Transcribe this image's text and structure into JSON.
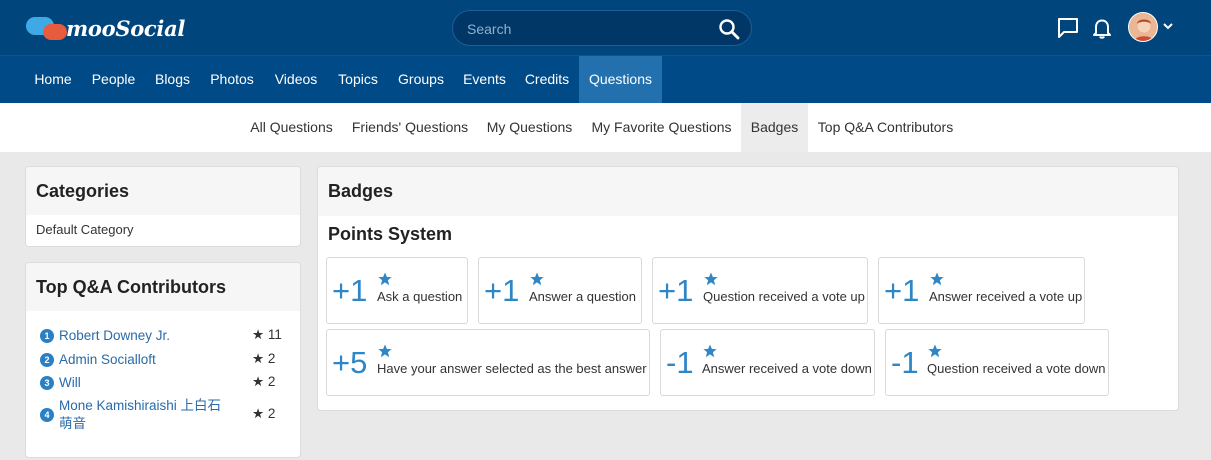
{
  "header": {
    "logo_text": "mooSocial",
    "search_placeholder": "Search"
  },
  "main_nav": [
    {
      "label": "Home"
    },
    {
      "label": "People"
    },
    {
      "label": "Blogs"
    },
    {
      "label": "Photos"
    },
    {
      "label": "Videos"
    },
    {
      "label": "Topics"
    },
    {
      "label": "Groups"
    },
    {
      "label": "Events"
    },
    {
      "label": "Credits"
    },
    {
      "label": "Questions",
      "active": true
    }
  ],
  "sub_nav": [
    {
      "label": "All Questions"
    },
    {
      "label": "Friends' Questions"
    },
    {
      "label": "My Questions"
    },
    {
      "label": "My Favorite Questions"
    },
    {
      "label": "Badges",
      "active": true
    },
    {
      "label": "Top Q&A Contributors"
    }
  ],
  "sidebar": {
    "categories": {
      "title": "Categories",
      "items": [
        "Default Category"
      ]
    },
    "contributors": {
      "title": "Top Q&A Contributors",
      "items": [
        {
          "rank": "1",
          "name": "Robert Downey Jr.",
          "points": "★ 11"
        },
        {
          "rank": "2",
          "name": "Admin Socialloft",
          "points": "★ 2"
        },
        {
          "rank": "3",
          "name": "Will",
          "points": "★ 2"
        },
        {
          "rank": "4",
          "name_line1": "Mone Kamishiraishi 上白石",
          "name_line2": "萌音",
          "points": "★ 2"
        }
      ]
    }
  },
  "badges": {
    "title": "Badges",
    "section_title": "Points System",
    "points": [
      {
        "value": "+1",
        "label": "Ask a question"
      },
      {
        "value": "+1",
        "label": "Answer a question"
      },
      {
        "value": "+1",
        "label": "Question received a vote up"
      },
      {
        "value": "+1",
        "label": "Answer received a vote up"
      },
      {
        "value": "+5",
        "label": "Have your answer selected as the best answer"
      },
      {
        "value": "-1",
        "label": "Answer received a vote down"
      },
      {
        "value": "-1",
        "label": "Question received a vote down"
      }
    ]
  },
  "colors": {
    "header_bg": "#00457c",
    "nav_bg": "#004a87",
    "nav_active": "#2270ad",
    "accent": "#2f86c7",
    "link": "#2a6aa8"
  },
  "icons": {
    "search": "search-icon",
    "messages": "chat-icon",
    "notifications": "bell-icon",
    "user_menu": "chevron-down-icon",
    "points": "star-icon"
  }
}
